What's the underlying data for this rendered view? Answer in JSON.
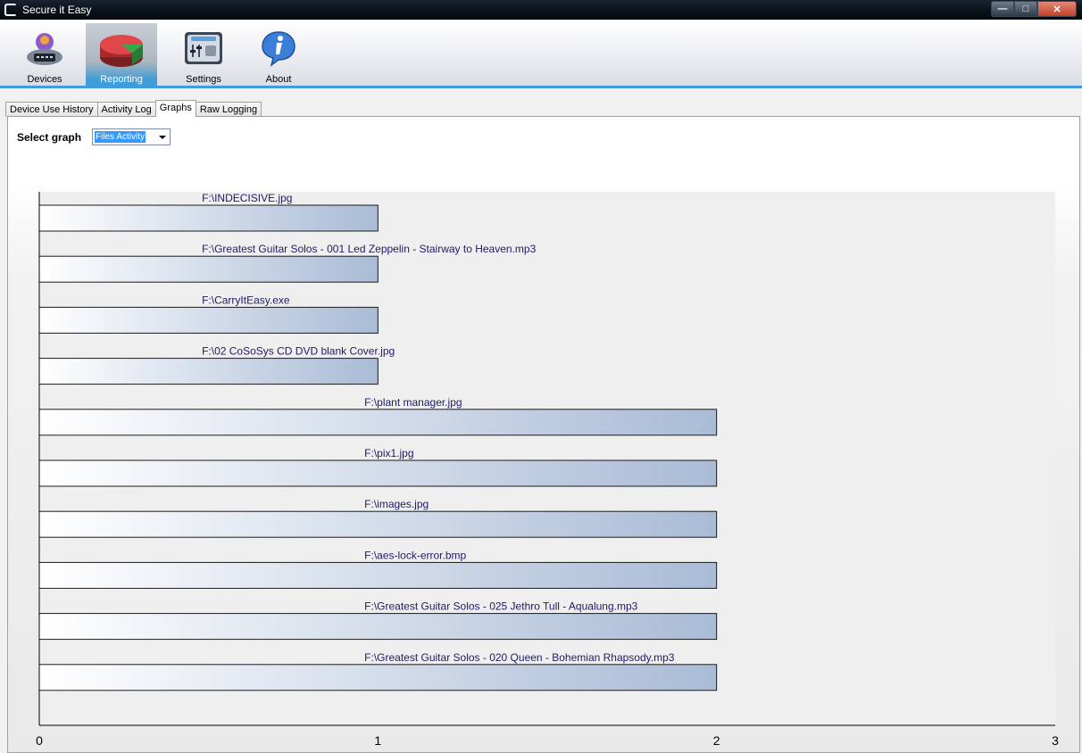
{
  "window": {
    "title": "Secure it Easy"
  },
  "toolbar": {
    "items": [
      {
        "label": "Devices",
        "icon": "devices-icon"
      },
      {
        "label": "Reporting",
        "icon": "reporting-pie-icon",
        "selected": true
      },
      {
        "label": "Settings",
        "icon": "settings-panel-icon"
      },
      {
        "label": "About",
        "icon": "info-bubble-icon"
      }
    ]
  },
  "tabs": [
    {
      "label": "Device Use History"
    },
    {
      "label": "Activity Log"
    },
    {
      "label": "Graphs",
      "active": true
    },
    {
      "label": "Raw Logging"
    }
  ],
  "graph_select": {
    "label": "Select graph",
    "value": "Files Activity"
  },
  "colors": {
    "accent": "#3f9ed8",
    "bar_end": "#a9bbd6",
    "label": "#1f1a66"
  },
  "chart_data": {
    "type": "bar",
    "orientation": "horizontal",
    "categories": [
      "F:\\INDECISIVE.jpg",
      "F:\\Greatest Guitar Solos - 001 Led Zeppelin - Stairway to Heaven.mp3",
      "F:\\CarryItEasy.exe",
      "F:\\02 CoSoSys CD DVD blank Cover.jpg",
      "F:\\plant manager.jpg",
      "F:\\pix1.jpg",
      "F:\\images.jpg",
      "F:\\aes-lock-error.bmp",
      "F:\\Greatest Guitar Solos - 025 Jethro Tull - Aqualung.mp3",
      "F:\\Greatest Guitar Solos - 020 Queen - Bohemian Rhapsody.mp3"
    ],
    "values": [
      1,
      1,
      1,
      1,
      2,
      2,
      2,
      2,
      2,
      2
    ],
    "xlim": [
      0,
      3
    ],
    "xticks": [
      "0",
      "1",
      "2",
      "3"
    ],
    "grid": false,
    "legend": "none"
  }
}
